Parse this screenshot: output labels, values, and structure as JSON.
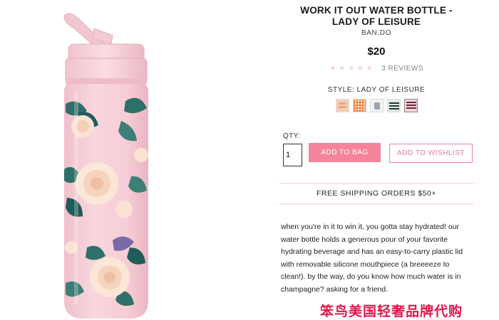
{
  "product": {
    "title_line1": "WORK IT OUT WATER BOTTLE -",
    "title_line2": "LADY OF LEISURE",
    "brand": "BAN.DO",
    "price": "$20",
    "rating": {
      "stars": "★★★★★",
      "filled": 0,
      "reviews": "3 REVIEWS"
    },
    "style_label": "STYLE: LADY OF LEISURE",
    "swatches": [
      {
        "name": "style-swatch-1"
      },
      {
        "name": "style-swatch-2"
      },
      {
        "name": "style-swatch-3"
      },
      {
        "name": "style-swatch-4"
      },
      {
        "name": "style-swatch-5"
      }
    ]
  },
  "purchase": {
    "qty_label": "QTY:",
    "qty_value": "1",
    "add_to_bag": "ADD TO BAG",
    "add_to_wishlist": "ADD TO WISHLIST"
  },
  "shipping": "FREE SHIPPING ORDERS $50+",
  "description": "when you're in it to win it, you gotta stay hydrated! our water bottle holds a generous pour of your favorite hydrating beverage and has an easy-to-carry plastic lid with removable silicone mouthpiece (a breeeeze to clean!). by the way, do you know how much water is in champagne? asking for a friend.",
  "watermark": "笨鸟美国轻奢品牌代购",
  "colors": {
    "accent_pink": "#f4849b",
    "divider_pink": "#fbe1e7",
    "bottle_pink": "#f6cdd6",
    "leaf_teal": "#2f6f6a"
  }
}
